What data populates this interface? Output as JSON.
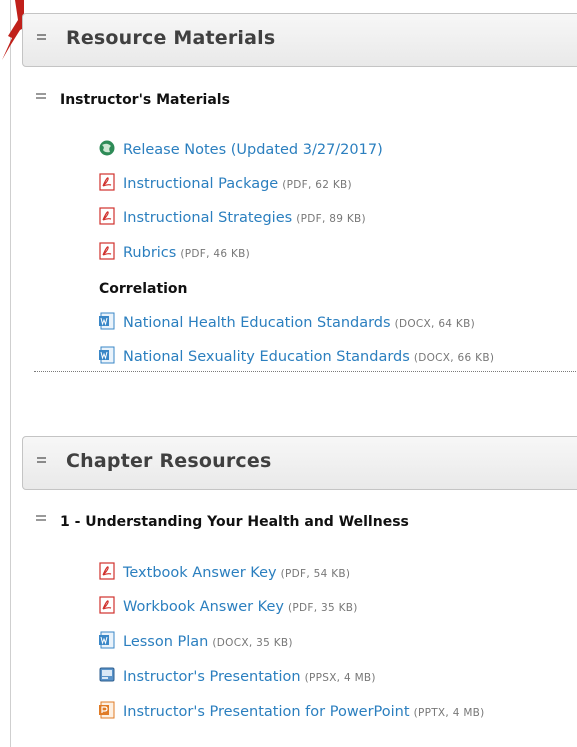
{
  "sections": [
    {
      "title": "Resource Materials",
      "subsections": [
        {
          "title": "Instructor's Materials",
          "items": [
            {
              "icon": "web-link-icon",
              "label": "Release Notes (Updated 3/27/2017)",
              "meta": ""
            },
            {
              "icon": "pdf-icon",
              "label": "Instructional Package",
              "meta": "(PDF, 62 KB)"
            },
            {
              "icon": "pdf-icon",
              "label": "Instructional Strategies",
              "meta": "(PDF, 89 KB)"
            },
            {
              "icon": "pdf-icon",
              "label": "Rubrics",
              "meta": "(PDF, 46 KB)"
            }
          ],
          "group_label": "Correlation",
          "group_items": [
            {
              "icon": "word-doc-icon",
              "label": "National Health Education Standards",
              "meta": "(DOCX, 64 KB)"
            },
            {
              "icon": "word-doc-icon",
              "label": "National Sexuality Education Standards",
              "meta": "(DOCX, 66 KB)"
            }
          ]
        }
      ]
    },
    {
      "title": "Chapter Resources",
      "subsections": [
        {
          "title": "1 - Understanding Your Health and Wellness",
          "items": [
            {
              "icon": "pdf-icon",
              "label": "Textbook Answer Key",
              "meta": "(PDF, 54 KB)"
            },
            {
              "icon": "pdf-icon",
              "label": "Workbook Answer Key",
              "meta": "(PDF, 35 KB)"
            },
            {
              "icon": "word-doc-icon",
              "label": "Lesson Plan",
              "meta": "(DOCX, 35 KB)"
            },
            {
              "icon": "slideshow-icon",
              "label": "Instructor's Presentation",
              "meta": "(PPSX, 4 MB)"
            },
            {
              "icon": "powerpoint-icon",
              "label": "Instructor's Presentation for PowerPoint",
              "meta": "(PPTX, 4 MB)"
            }
          ]
        }
      ]
    }
  ],
  "colors": {
    "link": "#2b7fbf",
    "arrow": "#c0201a",
    "pdf": "#d0312d",
    "doc": "#3a87c7",
    "pptx": "#e07b26"
  }
}
